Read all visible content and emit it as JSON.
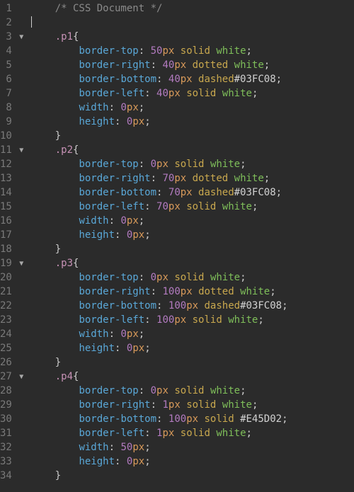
{
  "lines": [
    {
      "n": 1
    },
    {
      "n": 2
    },
    {
      "n": 3,
      "fold": true
    },
    {
      "n": 4
    },
    {
      "n": 5
    },
    {
      "n": 6
    },
    {
      "n": 7
    },
    {
      "n": 8
    },
    {
      "n": 9
    },
    {
      "n": 10
    },
    {
      "n": 11,
      "fold": true
    },
    {
      "n": 12
    },
    {
      "n": 13
    },
    {
      "n": 14
    },
    {
      "n": 15
    },
    {
      "n": 16
    },
    {
      "n": 17
    },
    {
      "n": 18
    },
    {
      "n": 19,
      "fold": true
    },
    {
      "n": 20
    },
    {
      "n": 21
    },
    {
      "n": 22
    },
    {
      "n": 23
    },
    {
      "n": 24
    },
    {
      "n": 25
    },
    {
      "n": 26
    },
    {
      "n": 27,
      "fold": true
    },
    {
      "n": 28
    },
    {
      "n": 29
    },
    {
      "n": 30
    },
    {
      "n": 31
    },
    {
      "n": 32
    },
    {
      "n": 33
    },
    {
      "n": 34
    }
  ],
  "indent": "    ",
  "indent2": "        ",
  "comment": "/* CSS Document */",
  "tokens": {
    "bt": "border-top",
    "br": "border-right",
    "bb": "border-bottom",
    "bl": "border-left",
    "w": "width",
    "h": "height",
    "solid": "solid",
    "dotted": "dotted",
    "dashed": "dashed",
    "white": "white",
    "px": "px",
    "hex1": "#03FC08",
    "hex2": "#E45D02",
    "obr": "{",
    "cbr": "}",
    "col": ":",
    "semi": ";"
  },
  "selectors": {
    "p1": ".p1",
    "p2": ".p2",
    "p3": ".p3",
    "p4": ".p4"
  },
  "vals": {
    "p1": {
      "bt": "50",
      "br": "40",
      "bb": "40",
      "bl": "40",
      "w": "0",
      "h": "0"
    },
    "p2": {
      "bt": "0",
      "br": "70",
      "bb": "70",
      "bl": "70",
      "w": "0",
      "h": "0"
    },
    "p3": {
      "bt": "0",
      "br": "100",
      "bb": "100",
      "bl": "100",
      "w": "0",
      "h": "0"
    },
    "p4": {
      "bt": "0",
      "br": "1",
      "bb": "100",
      "bl": "1",
      "w": "50",
      "h": "0"
    }
  }
}
